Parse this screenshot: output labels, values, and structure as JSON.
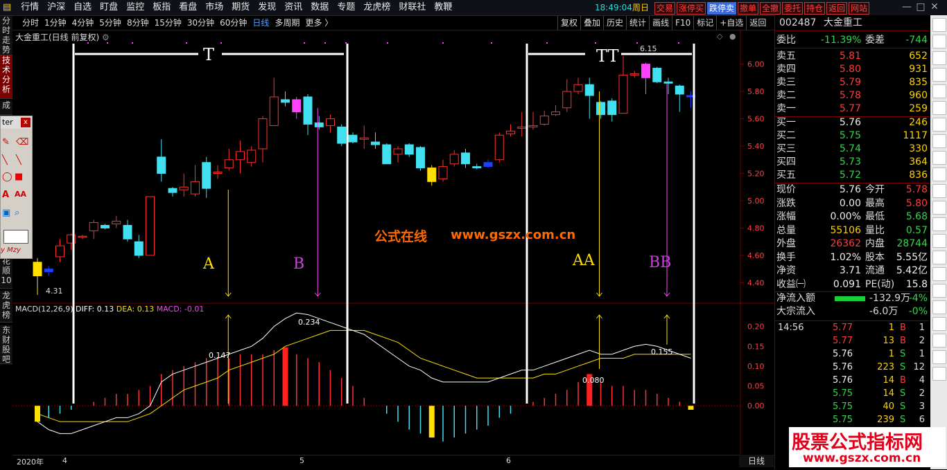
{
  "topbar": {
    "menu": [
      "行情",
      "沪深",
      "自选",
      "盯盘",
      "监控",
      "板指",
      "看盘",
      "市场",
      "期货",
      "发现",
      "资讯",
      "数据",
      "专题",
      "龙虎榜",
      "财联社",
      "教鞭"
    ],
    "clock": "18:49:04",
    "weekday": "周日",
    "trade_buttons": [
      "交易",
      "涨停买",
      "跌停卖",
      "撤单",
      "全撤",
      "委托",
      "持仓",
      "返回",
      "网站"
    ],
    "window_controls": [
      "—",
      "□",
      "✕"
    ]
  },
  "periodbar": {
    "items": [
      "分时",
      "1分钟",
      "4分钟",
      "5分钟",
      "8分钟",
      "15分钟",
      "30分钟",
      "60分钟",
      "日线",
      "多周期",
      "更多 〉"
    ],
    "active": "日线",
    "tools": [
      "复权",
      "叠加",
      "历史",
      "统计",
      "画线",
      "F10",
      "标记",
      "+自选",
      "返回"
    ]
  },
  "left_tabs": [
    {
      "label": "分时走势",
      "active": false
    },
    {
      "label": "技术分析",
      "active": true
    },
    {
      "label": "成",
      "active": false
    },
    {
      "label": "花顺",
      "active": false
    },
    {
      "label": "10",
      "active": false
    },
    {
      "label": "龙虎榜",
      "active": false
    },
    {
      "label": "东财股吧",
      "active": false
    }
  ],
  "palette": {
    "title": "ter",
    "close": "x",
    "footer": "y Mzy"
  },
  "chart": {
    "stock_title": "大金重工(日线 前复权)",
    "macd_name": "MACD(12,26,9)",
    "diff": "DIFF: 0.13",
    "dea": "DEA: 0.13",
    "macd": "MACD: -0.01",
    "watermark_cn": "公式在线",
    "watermark_url": "www.gszx.com.cn",
    "annotations": [
      "T",
      "TT",
      "A",
      "B",
      "AA",
      "BB"
    ],
    "price_low": "4.31",
    "price_high": "6.15",
    "macd_labels": [
      "0.147",
      "0.234",
      "0.080",
      "0.155"
    ],
    "price_axis": [
      "6.00",
      "5.80",
      "5.60",
      "5.40",
      "5.20",
      "5.00",
      "4.80",
      "4.60",
      "4.40"
    ],
    "macd_axis": [
      "0.20",
      "0.15",
      "0.10",
      "0.05",
      "0.00"
    ],
    "date_labels": [
      "2020年",
      "4",
      "5",
      "6"
    ],
    "period_tag": "日线",
    "colors": {
      "up": "#ff3030",
      "down": "#40e0f0",
      "diff": "#ffffff",
      "dea": "#ffe000",
      "macd_marker": "#ff40ff"
    }
  },
  "quote": {
    "code": "002487",
    "name": "大金重工",
    "weibi_label": "委比",
    "weibi": "-11.39%",
    "weicha_label": "委差",
    "weicha": "-744",
    "sell": [
      {
        "label": "卖五",
        "price": "5.81",
        "vol": "652"
      },
      {
        "label": "卖四",
        "price": "5.80",
        "vol": "931"
      },
      {
        "label": "卖三",
        "price": "5.79",
        "vol": "835"
      },
      {
        "label": "卖二",
        "price": "5.78",
        "vol": "960"
      },
      {
        "label": "卖一",
        "price": "5.77",
        "vol": "259"
      }
    ],
    "buy": [
      {
        "label": "买一",
        "price": "5.76",
        "vol": "246"
      },
      {
        "label": "买二",
        "price": "5.75",
        "vol": "1117"
      },
      {
        "label": "买三",
        "price": "5.74",
        "vol": "330"
      },
      {
        "label": "买四",
        "price": "5.73",
        "vol": "364"
      },
      {
        "label": "买五",
        "price": "5.72",
        "vol": "836"
      }
    ],
    "stats": [
      {
        "l": "现价",
        "v": "5.76",
        "vc": "white",
        "l2": "今开",
        "v2": "5.78",
        "v2c": "red"
      },
      {
        "l": "涨跌",
        "v": "0.00",
        "vc": "white",
        "l2": "最高",
        "v2": "5.80",
        "v2c": "red"
      },
      {
        "l": "涨幅",
        "v": "0.00%",
        "vc": "white",
        "l2": "最低",
        "v2": "5.68",
        "v2c": "green"
      },
      {
        "l": "总量",
        "v": "55106",
        "vc": "yellow",
        "l2": "量比",
        "v2": "0.57",
        "v2c": "green"
      },
      {
        "l": "外盘",
        "v": "26362",
        "vc": "red",
        "l2": "内盘",
        "v2": "28744",
        "v2c": "green"
      },
      {
        "l": "换手",
        "v": "1.02%",
        "vc": "white",
        "l2": "股本",
        "v2": "5.55亿",
        "v2c": "white"
      },
      {
        "l": "净资",
        "v": "3.71",
        "vc": "white",
        "l2": "流通",
        "v2": "5.42亿",
        "v2c": "white"
      },
      {
        "l": "收益㈠",
        "v": "0.091",
        "vc": "white",
        "l2": "PE(动)",
        "v2": "15.8",
        "v2c": "white"
      }
    ],
    "flow": [
      {
        "label": "净流入额",
        "value": "-132.9万",
        "pct": "-4%"
      },
      {
        "label": "大宗流入",
        "value": "-6.0万",
        "pct": "-0%"
      }
    ],
    "ticks": [
      {
        "t": "14:56",
        "p": "5.77",
        "pc": "red",
        "q": "1",
        "bs": "B",
        "n": "1"
      },
      {
        "t": "",
        "p": "5.77",
        "pc": "red",
        "q": "13",
        "bs": "B",
        "n": "2"
      },
      {
        "t": "",
        "p": "5.76",
        "pc": "white",
        "q": "1",
        "bs": "S",
        "n": "1"
      },
      {
        "t": "",
        "p": "5.76",
        "pc": "white",
        "q": "223",
        "bs": "S",
        "n": "12"
      },
      {
        "t": "",
        "p": "5.76",
        "pc": "white",
        "q": "14",
        "bs": "B",
        "n": "4"
      },
      {
        "t": "",
        "p": "5.75",
        "pc": "green",
        "q": "14",
        "bs": "S",
        "n": "2"
      },
      {
        "t": "",
        "p": "5.75",
        "pc": "green",
        "q": "40",
        "bs": "S",
        "n": "3"
      },
      {
        "t": "",
        "p": "5.75",
        "pc": "green",
        "q": "239",
        "bs": "S",
        "n": "6"
      }
    ]
  },
  "logo": {
    "line1": "股票公式指标网",
    "line2": "www.gszx.com.cn"
  },
  "chart_data": {
    "type": "candlestick",
    "title": "大金重工(日线 前复权)",
    "ylim": [
      4.25,
      6.15
    ],
    "candles": [
      {
        "o": 4.45,
        "c": 4.55,
        "h": 4.58,
        "l": 4.31
      },
      {
        "o": 4.48,
        "c": 4.5,
        "h": 4.52,
        "l": 4.45
      },
      {
        "o": 4.59,
        "c": 4.67,
        "h": 4.72,
        "l": 4.55
      },
      {
        "o": 4.69,
        "c": 4.75,
        "h": 4.76,
        "l": 4.64
      },
      {
        "o": 4.74,
        "c": 4.74,
        "h": 4.75,
        "l": 4.72
      },
      {
        "o": 4.78,
        "c": 4.84,
        "h": 4.86,
        "l": 4.72
      },
      {
        "o": 4.82,
        "c": 4.8,
        "h": 4.83,
        "l": 4.79
      },
      {
        "o": 4.83,
        "c": 4.85,
        "h": 4.89,
        "l": 4.8
      },
      {
        "o": 4.82,
        "c": 4.72,
        "h": 4.86,
        "l": 4.7
      },
      {
        "o": 4.7,
        "c": 4.6,
        "h": 4.75,
        "l": 4.58
      },
      {
        "o": 4.6,
        "c": 5.03,
        "h": 5.03,
        "l": 4.6
      },
      {
        "o": 5.32,
        "c": 5.2,
        "h": 5.45,
        "l": 5.14
      },
      {
        "o": 5.09,
        "c": 5.06,
        "h": 5.1,
        "l": 5.03
      },
      {
        "o": 5.08,
        "c": 5.1,
        "h": 5.2,
        "l": 5.03
      },
      {
        "o": 5.05,
        "c": 5.14,
        "h": 5.26,
        "l": 5.03
      },
      {
        "o": 5.28,
        "c": 5.09,
        "h": 5.32,
        "l": 5.02
      },
      {
        "o": 5.2,
        "c": 5.21,
        "h": 5.26,
        "l": 5.16
      },
      {
        "o": 5.24,
        "c": 5.3,
        "h": 5.38,
        "l": 5.22
      },
      {
        "o": 5.3,
        "c": 5.36,
        "h": 5.44,
        "l": 5.2
      },
      {
        "o": 5.28,
        "c": 5.37,
        "h": 5.4,
        "l": 5.25
      },
      {
        "o": 5.38,
        "c": 5.6,
        "h": 5.62,
        "l": 5.28
      },
      {
        "o": 5.55,
        "c": 5.76,
        "h": 5.9,
        "l": 5.55
      },
      {
        "o": 5.74,
        "c": 5.72,
        "h": 5.8,
        "l": 5.69
      },
      {
        "o": 5.74,
        "c": 5.65,
        "h": 5.76,
        "l": 5.6
      },
      {
        "o": 5.76,
        "c": 5.56,
        "h": 5.78,
        "l": 5.48
      },
      {
        "o": 5.57,
        "c": 5.54,
        "h": 5.62,
        "l": 5.52
      },
      {
        "o": 5.55,
        "c": 5.6,
        "h": 5.63,
        "l": 5.5
      },
      {
        "o": 5.54,
        "c": 5.42,
        "h": 5.56,
        "l": 5.4
      },
      {
        "o": 5.48,
        "c": 5.43,
        "h": 5.5,
        "l": 5.42
      },
      {
        "o": 5.45,
        "c": 5.46,
        "h": 5.55,
        "l": 5.38
      },
      {
        "o": 5.43,
        "c": 5.41,
        "h": 5.5,
        "l": 5.38
      },
      {
        "o": 5.41,
        "c": 5.27,
        "h": 5.42,
        "l": 5.27
      },
      {
        "o": 5.34,
        "c": 5.38,
        "h": 5.4,
        "l": 5.28
      },
      {
        "o": 5.41,
        "c": 5.34,
        "h": 5.42,
        "l": 5.32
      },
      {
        "o": 5.39,
        "c": 5.24,
        "h": 5.4,
        "l": 5.22
      },
      {
        "o": 5.24,
        "c": 5.14,
        "h": 5.26,
        "l": 5.11
      },
      {
        "o": 5.16,
        "c": 5.25,
        "h": 5.3,
        "l": 5.14
      },
      {
        "o": 5.27,
        "c": 5.34,
        "h": 5.37,
        "l": 5.25
      },
      {
        "o": 5.35,
        "c": 5.27,
        "h": 5.38,
        "l": 5.24
      },
      {
        "o": 5.25,
        "c": 5.24,
        "h": 5.27,
        "l": 5.23
      },
      {
        "o": 5.28,
        "c": 5.25,
        "h": 5.3,
        "l": 5.24
      },
      {
        "o": 5.3,
        "c": 5.48,
        "h": 5.5,
        "l": 5.28
      },
      {
        "o": 5.49,
        "c": 5.51,
        "h": 5.56,
        "l": 5.47
      },
      {
        "o": 5.53,
        "c": 5.54,
        "h": 5.65,
        "l": 5.47
      },
      {
        "o": 5.54,
        "c": 5.55,
        "h": 5.65,
        "l": 5.52
      },
      {
        "o": 5.56,
        "c": 5.62,
        "h": 5.66,
        "l": 5.55
      },
      {
        "o": 5.63,
        "c": 5.65,
        "h": 5.7,
        "l": 5.62
      },
      {
        "o": 5.68,
        "c": 5.8,
        "h": 5.89,
        "l": 5.65
      },
      {
        "o": 5.8,
        "c": 5.85,
        "h": 5.9,
        "l": 5.78
      },
      {
        "o": 5.85,
        "c": 5.77,
        "h": 5.9,
        "l": 5.6
      },
      {
        "o": 5.72,
        "c": 5.63,
        "h": 5.73,
        "l": 5.6
      },
      {
        "o": 5.73,
        "c": 5.63,
        "h": 5.75,
        "l": 5.58
      },
      {
        "o": 5.64,
        "c": 5.92,
        "h": 6.06,
        "l": 5.64
      },
      {
        "o": 5.92,
        "c": 5.93,
        "h": 5.95,
        "l": 5.9
      },
      {
        "o": 6.0,
        "c": 5.9,
        "h": 6.01,
        "l": 5.78
      },
      {
        "o": 5.97,
        "c": 5.87,
        "h": 5.98,
        "l": 5.86
      },
      {
        "o": 5.87,
        "c": 5.86,
        "h": 5.9,
        "l": 5.78
      },
      {
        "o": 5.84,
        "c": 5.78,
        "h": 5.85,
        "l": 5.65
      },
      {
        "o": 5.77,
        "c": 5.76,
        "h": 5.8,
        "l": 5.68
      }
    ],
    "macd_hist": [
      -0.04,
      -0.03,
      -0.02,
      -0.01,
      0.0,
      0.01,
      0.02,
      0.03,
      0.03,
      0.04,
      0.05,
      0.08,
      0.09,
      0.1,
      0.11,
      0.12,
      0.12,
      0.12,
      0.13,
      0.13,
      0.13,
      0.14,
      0.147,
      0.13,
      0.12,
      0.11,
      0.09,
      0.07,
      0.05,
      0.02,
      0.0,
      -0.02,
      -0.04,
      -0.06,
      -0.07,
      -0.08,
      -0.09,
      -0.08,
      -0.07,
      -0.06,
      -0.05,
      -0.03,
      -0.02,
      0.0,
      0.01,
      0.02,
      0.03,
      0.04,
      0.06,
      0.08,
      0.06,
      0.05,
      0.05,
      0.04,
      0.04,
      0.03,
      0.02,
      0.01,
      -0.01
    ],
    "diff": [
      -0.04,
      -0.06,
      -0.07,
      -0.07,
      -0.06,
      -0.05,
      -0.04,
      -0.03,
      -0.03,
      -0.02,
      0.0,
      0.06,
      0.08,
      0.09,
      0.1,
      0.11,
      0.12,
      0.13,
      0.14,
      0.15,
      0.17,
      0.2,
      0.22,
      0.234,
      0.23,
      0.22,
      0.21,
      0.2,
      0.19,
      0.18,
      0.16,
      0.14,
      0.12,
      0.1,
      0.09,
      0.07,
      0.06,
      0.06,
      0.06,
      0.06,
      0.06,
      0.07,
      0.08,
      0.09,
      0.09,
      0.1,
      0.11,
      0.12,
      0.13,
      0.14,
      0.13,
      0.13,
      0.14,
      0.15,
      0.155,
      0.15,
      0.14,
      0.13,
      0.12
    ],
    "dea": [
      -0.02,
      -0.03,
      -0.04,
      -0.04,
      -0.04,
      -0.04,
      -0.04,
      -0.04,
      -0.04,
      -0.03,
      -0.02,
      0.0,
      0.02,
      0.04,
      0.05,
      0.06,
      0.07,
      0.09,
      0.1,
      0.11,
      0.12,
      0.13,
      0.15,
      0.16,
      0.17,
      0.18,
      0.19,
      0.19,
      0.19,
      0.19,
      0.18,
      0.17,
      0.16,
      0.14,
      0.12,
      0.11,
      0.1,
      0.09,
      0.08,
      0.07,
      0.07,
      0.07,
      0.07,
      0.07,
      0.07,
      0.08,
      0.08,
      0.09,
      0.1,
      0.11,
      0.12,
      0.12,
      0.12,
      0.13,
      0.13,
      0.13,
      0.13,
      0.13,
      0.13
    ],
    "macd_ylim": [
      -0.12,
      0.25
    ]
  }
}
